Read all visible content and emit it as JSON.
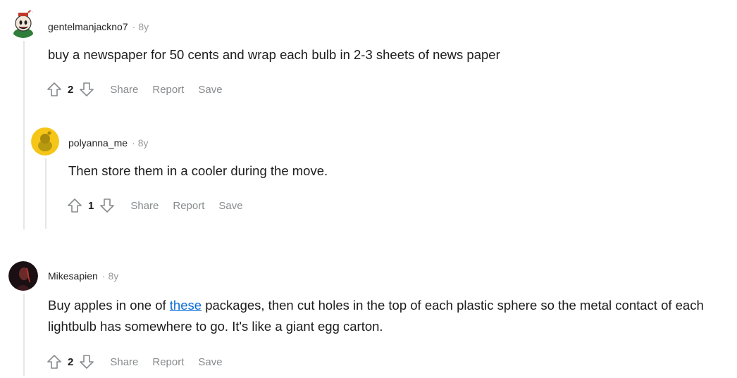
{
  "comments": [
    {
      "author": "gentelmanjackno7",
      "separator": "·",
      "age": "8y",
      "body": "buy a newspaper for 50 cents and wrap each bulb in 2-3 sheets of news paper",
      "votes": "2",
      "share": "Share",
      "report": "Report",
      "save": "Save",
      "avatar_icon": "cuphead-avatar"
    },
    {
      "author": "polyanna_me",
      "separator": "·",
      "age": "8y",
      "body": "Then store them in a cooler during the move.",
      "votes": "1",
      "share": "Share",
      "report": "Report",
      "save": "Save",
      "avatar_icon": "yellow-snoo-avatar"
    },
    {
      "author": "Mikesapien",
      "separator": "·",
      "age": "8y",
      "body_before": "Buy apples in one of ",
      "link": "these",
      "body_after": " packages, then cut holes in the top of each plastic sphere so the metal contact of each lightbulb has somewhere to go. It's like a giant egg carton.",
      "votes": "2",
      "share": "Share",
      "report": "Report",
      "save": "Save",
      "avatar_icon": "dark-portrait-avatar"
    }
  ],
  "colors": {
    "link": "#0a6bd6",
    "meta": "#9a9a9a",
    "action": "#878a8c",
    "thread_line": "#e6e6e6"
  }
}
